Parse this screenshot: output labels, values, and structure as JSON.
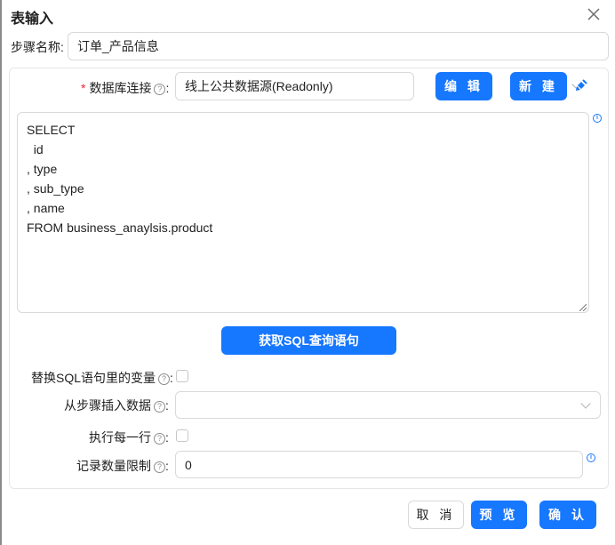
{
  "dialog": {
    "title": "表输入"
  },
  "step_name": {
    "label": "步骤名称:",
    "value": "订单_产品信息"
  },
  "db_connection": {
    "required_mark": "*",
    "label": "数据库连接",
    "colon": ":",
    "selected": "线上公共数据源(Readonly)",
    "edit_label": "编 辑",
    "new_label": "新 建"
  },
  "sql": {
    "text": "SELECT\n  id\n, type\n, sub_type\n, name\nFROM business_anaylsis.product",
    "fetch_button": "获取SQL查询语句"
  },
  "replace_vars": {
    "label": "替换SQL语句里的变量",
    "colon": ":",
    "checked": false
  },
  "insert_from_step": {
    "label": "从步骤插入数据",
    "colon": ":",
    "value": ""
  },
  "execute_each_row": {
    "label": "执行每一行",
    "colon": ":",
    "checked": false
  },
  "record_limit": {
    "label": "记录数量限制",
    "colon": ":",
    "value": "0"
  },
  "footer": {
    "cancel": "取 消",
    "preview": "预 览",
    "confirm": "确 认"
  },
  "icons": {
    "help": "?",
    "info": "i",
    "close": "close-icon",
    "clean": "broom-icon"
  },
  "colors": {
    "primary": "#1677ff",
    "required": "#f5222d",
    "border": "#d9d9d9"
  }
}
